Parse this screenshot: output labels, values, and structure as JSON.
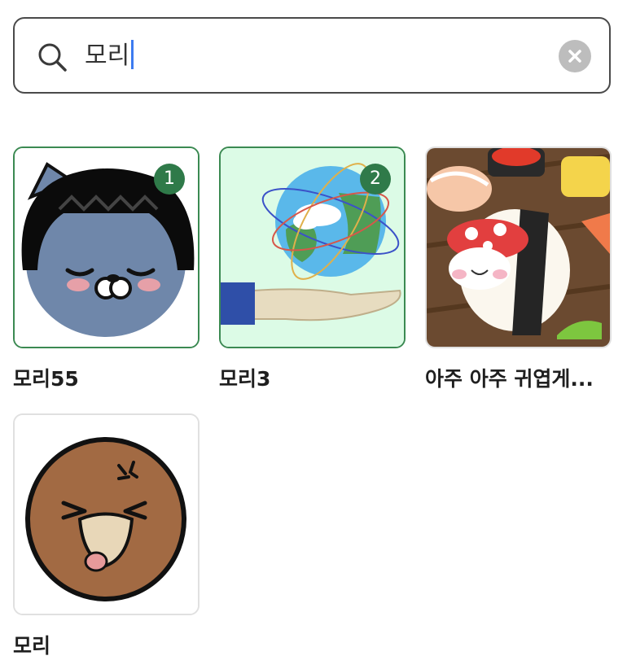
{
  "search": {
    "query": "모리",
    "icon": "search-icon",
    "clear_icon": "clear-icon"
  },
  "results": [
    {
      "title": "모리55",
      "badge": "1",
      "image": "black-haired-cat-sticker",
      "selected": true
    },
    {
      "title": "모리3",
      "badge": "2",
      "image": "globe-in-hand-sticker",
      "selected": true
    },
    {
      "title": "아주 아주 귀엽게...",
      "image": "sushi-character-sticker",
      "selected": false
    },
    {
      "title": "모리",
      "image": "angry-brown-ball-sticker",
      "selected": false
    }
  ],
  "colors": {
    "accent": "#2f7a49",
    "caret": "#3d7bf0",
    "border": "#4a4a4a"
  }
}
